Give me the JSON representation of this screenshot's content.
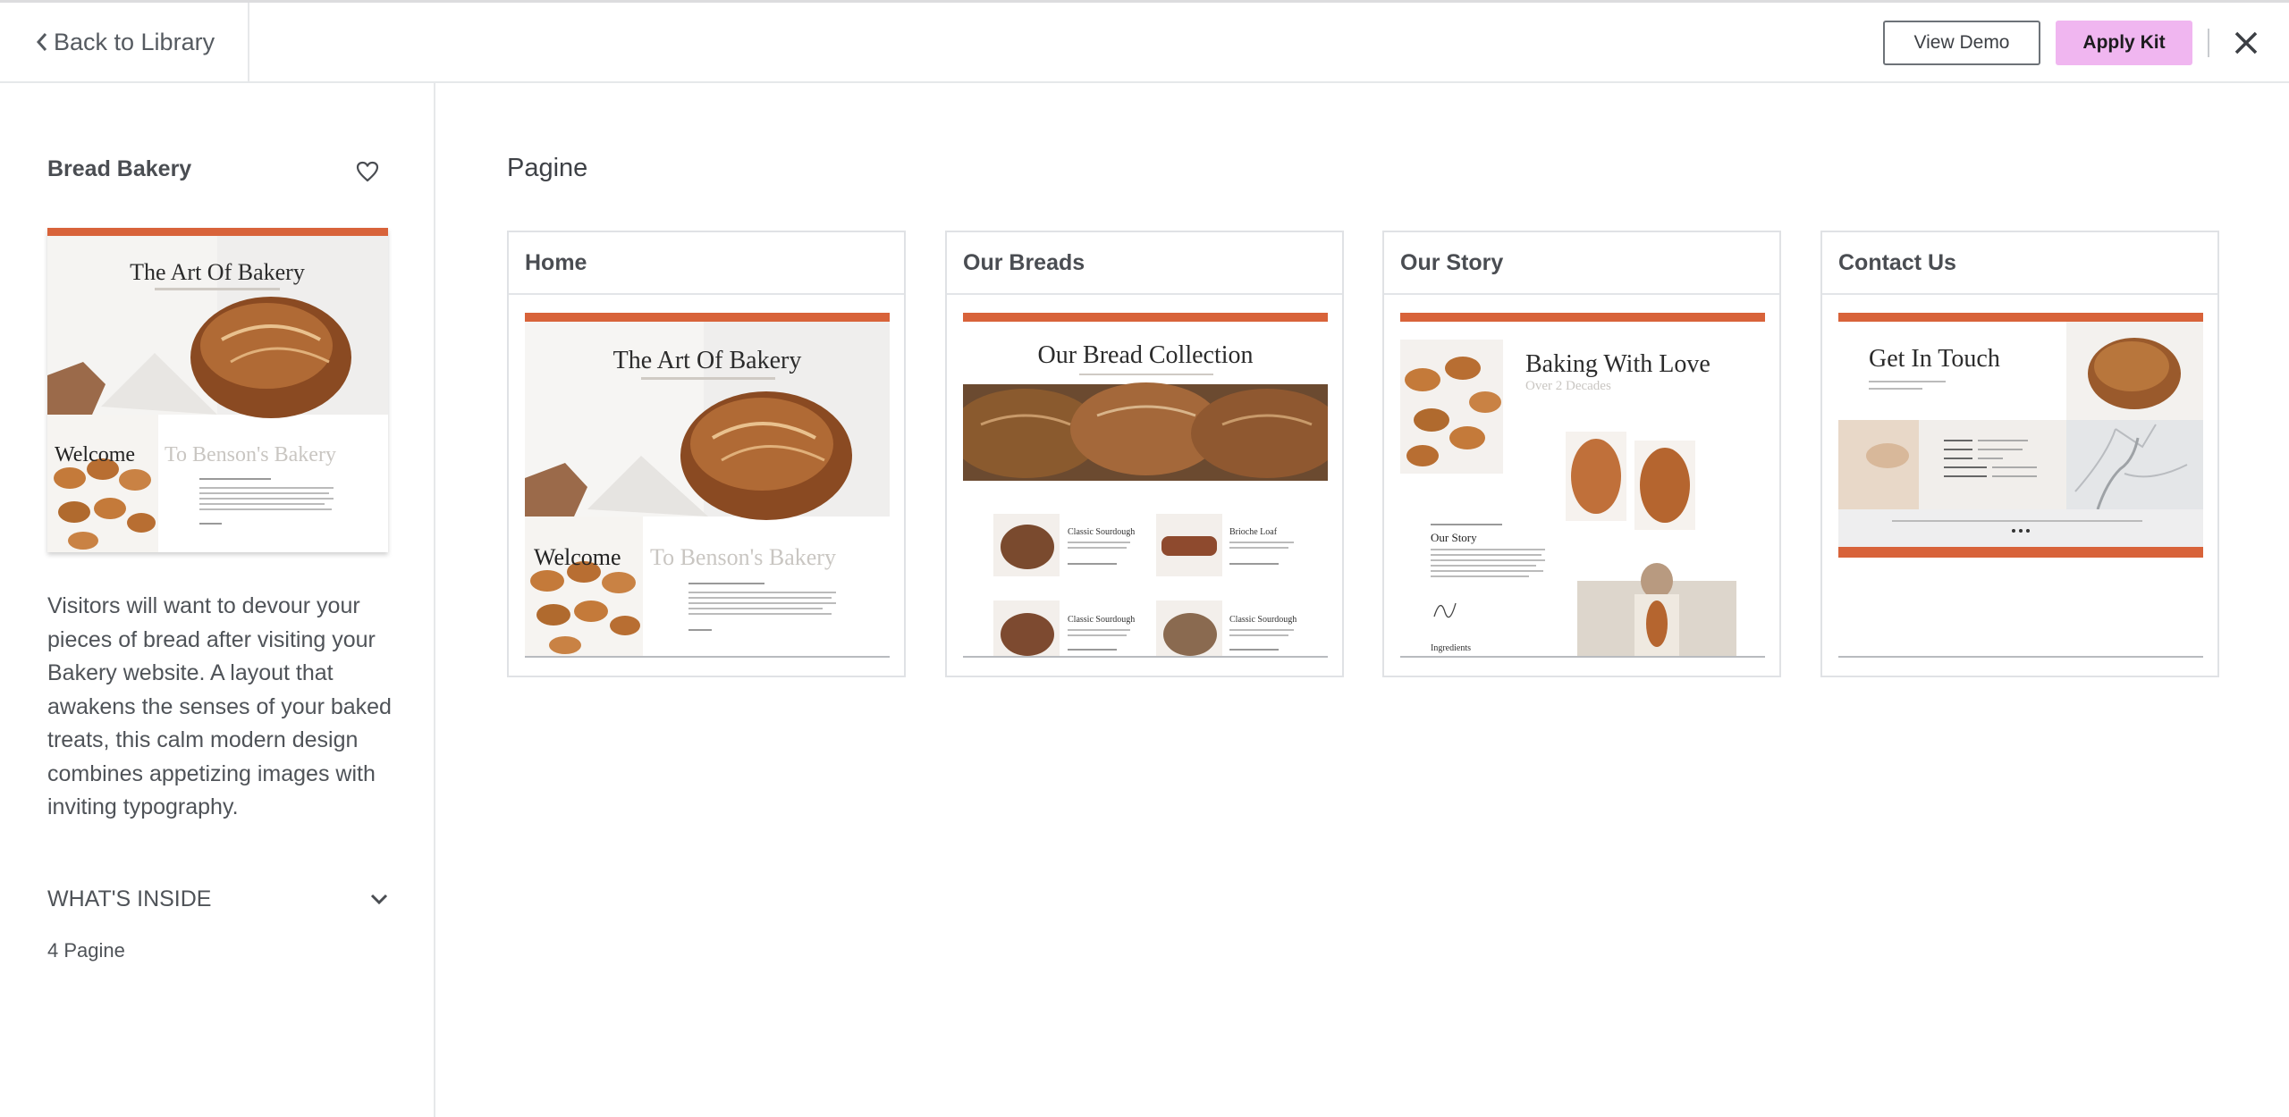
{
  "header": {
    "back_label": "Back to Library",
    "view_demo_label": "View Demo",
    "apply_kit_label": "Apply Kit"
  },
  "sidebar": {
    "kit_name": "Bread Bakery",
    "thumb": {
      "hero_title": "The Art Of Bakery",
      "welcome_word": "Welcome",
      "welcome_rest": "To Benson's Bakery"
    },
    "description": "Visitors will want to devour your pieces of bread after visiting your Bakery website. A layout that awakens the senses of your baked treats, this calm modern design combines appetizing images with inviting typography.",
    "whats_inside_label": "WHAT'S INSIDE",
    "pages_count": "4 Pagine"
  },
  "main": {
    "section_title": "Pagine",
    "pages": [
      {
        "title": "Home",
        "preview": {
          "hero_title": "The Art Of Bakery",
          "welcome_word": "Welcome",
          "welcome_rest": "To Benson's Bakery"
        }
      },
      {
        "title": "Our Breads",
        "preview": {
          "heading": "Our Bread Collection",
          "items": [
            "Classic Sourdough",
            "Brioche Loaf",
            "Classic Sourdough",
            "Classic Sourdough"
          ]
        }
      },
      {
        "title": "Our Story",
        "preview": {
          "heading": "Baking With Love",
          "subheading": "Over 2 Decades",
          "story_title": "Our Story",
          "ingredients_label": "Ingredients"
        }
      },
      {
        "title": "Contact Us",
        "preview": {
          "heading": "Get In Touch"
        }
      }
    ]
  },
  "colors": {
    "accent_orange": "#d8633a",
    "apply_button_bg": "#f0b6f0",
    "bread_crust": "#8a4a22"
  }
}
